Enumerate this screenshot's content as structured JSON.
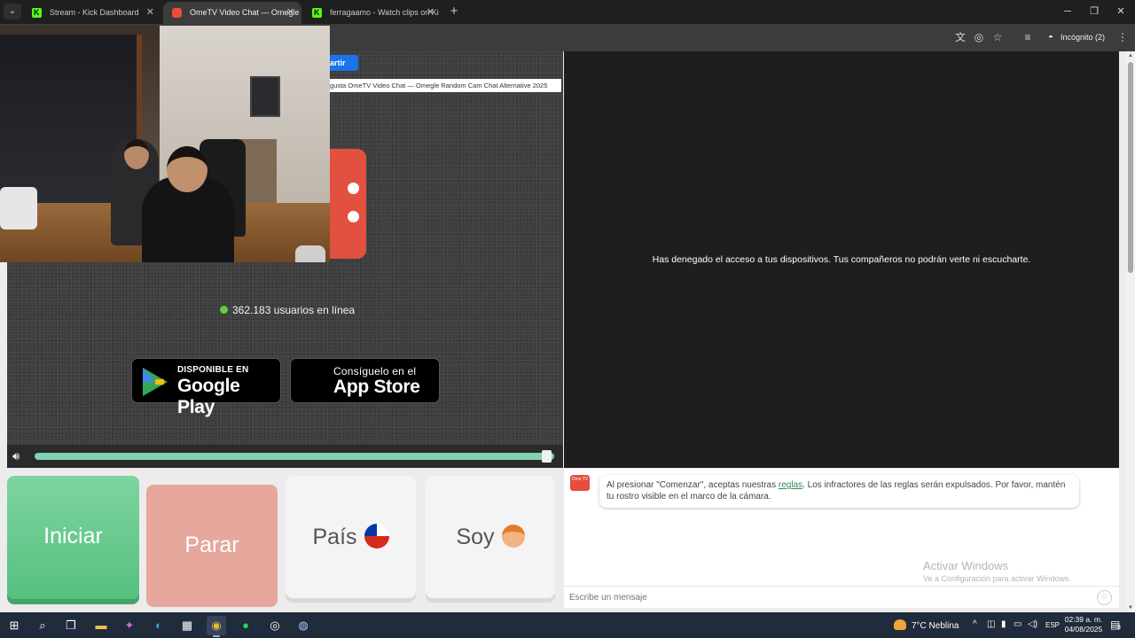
{
  "tabs": [
    {
      "title": "Stream - Kick Dashboard",
      "active": false,
      "favicon": "kick-icon"
    },
    {
      "title": "OmeTV Video Chat — Omegle",
      "active": true,
      "favicon": "ometv-icon"
    },
    {
      "title": "ferragaamo - Watch clips on Ki",
      "active": false,
      "favicon": "kick-icon"
    }
  ],
  "toolbar": {
    "profile_label": "Incógnito (2)"
  },
  "share": {
    "button_label": "artir",
    "tooltip": "gusta OmeTV Video Chat — Omegle Random Cam Chat Alternative 2025"
  },
  "video": {
    "online_count": "362.183 usuarios en línea",
    "denied_message": "Has denegado el acceso a tus dispositivos. Tus compañeros no podrán verte ni escucharte.",
    "volume_level": 0.99
  },
  "stores": {
    "google": {
      "small": "DISPONIBLE EN",
      "big": "Google Play"
    },
    "apple": {
      "small": "Consíguelo en el",
      "big": "App Store"
    }
  },
  "controls": {
    "start_label": "Iniciar",
    "stop_label": "Parar",
    "country_label": "País",
    "gender_label": "Soy"
  },
  "chat": {
    "logo_text": "Ome TV",
    "message_before": "Al presionar \"Comenzar\", aceptas nuestras ",
    "message_link": "reglas",
    "message_after": ". Los infractores de las reglas serán expulsados. Por favor, mantén tu rostro visible en el marco de la cámara.",
    "input_placeholder": "Escribe un mensaje"
  },
  "watermark": {
    "title": "Activar Windows",
    "subtitle": "Ve a Configuración para activar Windows."
  },
  "taskbar": {
    "weather": "7°C  Neblina",
    "language": "ESP",
    "time": "02:39 a. m.",
    "date": "04/08/2025",
    "notification_count": "3"
  },
  "colors": {
    "start": "#56c07f",
    "stop": "#e6a79c",
    "accent_blue": "#1a73e8",
    "online_dot": "#5fd03b",
    "volume_track": "#7fd3b0"
  }
}
